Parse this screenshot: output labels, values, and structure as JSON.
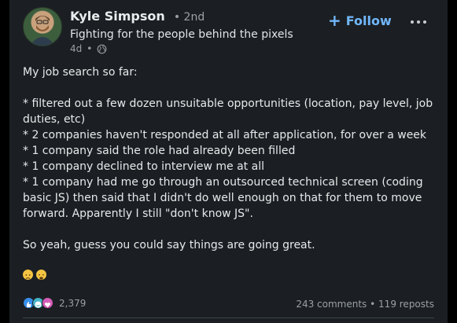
{
  "author": {
    "name": "Kyle Simpson",
    "degree": "• 2nd",
    "headline": "Fighting for the people behind the pixels",
    "time": "4d",
    "dot": "•"
  },
  "follow_label": "Follow",
  "post": {
    "lines": [
      "My job search so far:",
      "",
      "* filtered out a few dozen unsuitable opportunities (location, pay level, job duties, etc)",
      "* 2 companies haven't responded at all after application, for over a week",
      "* 1 company said the role had already been filled",
      "* 1 company declined to interview me at all",
      "* 1 company had me go through an outsourced technical screen (coding basic JS) then said that I didn't do well enough on that for them to move forward. Apparently I still \"don't know JS\".",
      "",
      "So yeah, guess you could say things are going great."
    ]
  },
  "reactions": {
    "count": "2,379",
    "types": [
      "like-icon",
      "funny-icon",
      "love-icon"
    ]
  },
  "stats": {
    "comments": "243 comments",
    "separator": "•",
    "reposts": "119 reposts"
  },
  "colors": {
    "background": "#1b1f23",
    "accent": "#71b7fb",
    "muted": "#9aa0a6"
  }
}
